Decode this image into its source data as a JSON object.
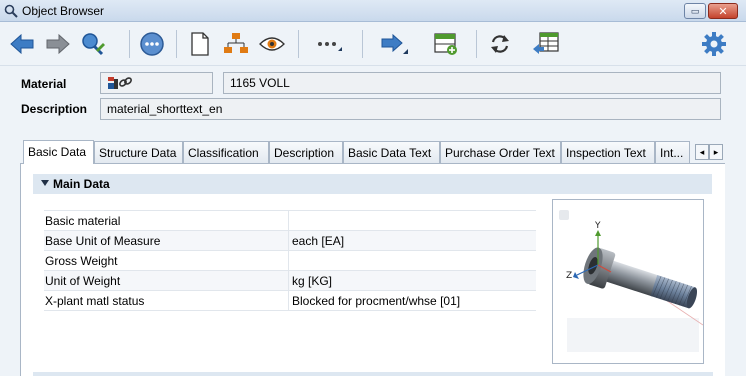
{
  "window": {
    "title": "Object Browser",
    "minimize_glyph": "▭",
    "close_glyph": "✕"
  },
  "toolbar": {
    "buttons": [
      {
        "name": "back-button",
        "icon": "arrow-left-icon"
      },
      {
        "name": "forward-button",
        "icon": "arrow-right-icon"
      },
      {
        "name": "edit-button",
        "icon": "edit-magnifier-icon"
      },
      {
        "name": "more-actions-button",
        "icon": "ellipsis-circle-icon"
      },
      {
        "name": "new-document-button",
        "icon": "document-icon"
      },
      {
        "name": "structure-button",
        "icon": "hierarchy-icon"
      },
      {
        "name": "view-button",
        "icon": "eye-icon"
      },
      {
        "name": "menu-button",
        "icon": "dots-icon"
      },
      {
        "name": "navigate-button",
        "icon": "arrow-right-blue-icon"
      },
      {
        "name": "add-table-button",
        "icon": "table-add-icon"
      },
      {
        "name": "refresh-button",
        "icon": "refresh-icon"
      },
      {
        "name": "export-button",
        "icon": "export-table-icon"
      },
      {
        "name": "settings-button",
        "icon": "gear-icon"
      }
    ]
  },
  "header": {
    "material_label": "Material",
    "material_value": "1165    VOLL",
    "description_label": "Description",
    "description_value": "material_shorttext_en"
  },
  "tabs": [
    {
      "label": "Basic Data",
      "active": true
    },
    {
      "label": "Structure Data"
    },
    {
      "label": "Classification"
    },
    {
      "label": "Description"
    },
    {
      "label": "Basic Data Text"
    },
    {
      "label": "Purchase Order Text"
    },
    {
      "label": "Inspection Text"
    },
    {
      "label": "Int..."
    }
  ],
  "tab_nav": {
    "prev": "◂",
    "next": "▸"
  },
  "main_data": {
    "title": "Main Data",
    "rows": [
      {
        "label": "Basic material",
        "value": ""
      },
      {
        "label": "Base Unit of Measure",
        "value": "each [EA]"
      },
      {
        "label": "Gross Weight",
        "value": ""
      },
      {
        "label": "Unit of Weight",
        "value": "kg [KG]"
      },
      {
        "label": "X-plant matl status",
        "value": "Blocked for procment/whse [01]"
      }
    ]
  },
  "preview": {
    "axis_y": "Y",
    "axis_z": "Z"
  },
  "colors": {
    "accent_blue": "#2b67b3",
    "green": "#4f9a2e",
    "orange": "#e07b14",
    "background": "#eef3f8"
  }
}
